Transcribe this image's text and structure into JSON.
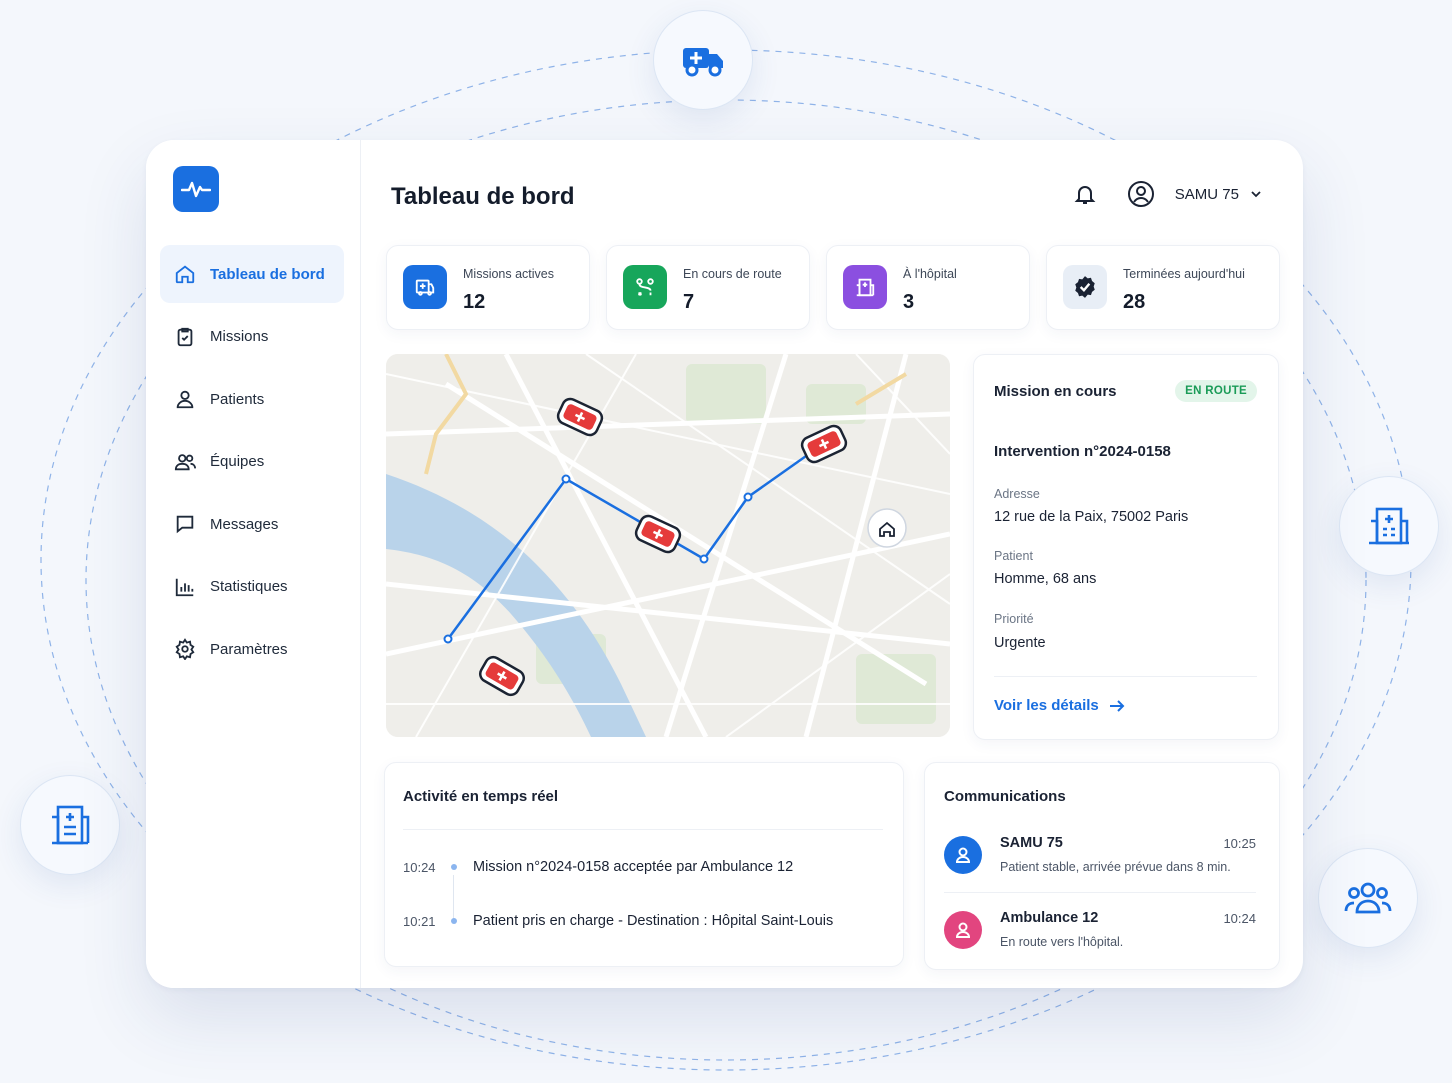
{
  "sidebar": {
    "items": [
      {
        "label": "Tableau de bord",
        "icon": "home-icon",
        "active": true
      },
      {
        "label": "Missions",
        "icon": "clipboard-check-icon"
      },
      {
        "label": "Patients",
        "icon": "user-icon"
      },
      {
        "label": "Équipes",
        "icon": "users-icon"
      },
      {
        "label": "Messages",
        "icon": "message-icon"
      },
      {
        "label": "Statistiques",
        "icon": "bar-chart-icon"
      },
      {
        "label": "Paramètres",
        "icon": "gear-icon"
      }
    ]
  },
  "header": {
    "title": "Tableau de bord",
    "user": "SAMU 75"
  },
  "stats": [
    {
      "label": "Missions actives",
      "value": "12",
      "color": "#1a6fe0",
      "icon": "ambulance-icon"
    },
    {
      "label": "En cours de route",
      "value": "7",
      "color": "#17a65b",
      "icon": "route-icon"
    },
    {
      "label": "À l'hôpital",
      "value": "3",
      "color": "#8b4fe0",
      "icon": "hospital-icon"
    },
    {
      "label": "Terminées aujourd'hui",
      "value": "28",
      "color": "#1a2233",
      "icon": "check-badge-icon"
    }
  ],
  "mission": {
    "heading": "Mission en cours",
    "status": "EN ROUTE",
    "number": "Intervention n°2024-0158",
    "address_label": "Adresse",
    "address": "12 rue de la Paix, 75002 Paris",
    "patient_label": "Patient",
    "patient": "Homme, 68 ans",
    "priority_label": "Priorité",
    "priority": "Urgente",
    "details_link": "Voir les détails"
  },
  "activity": {
    "heading": "Activité en temps réel",
    "items": [
      {
        "time": "10:24",
        "text": "Mission n°2024-0158 acceptée par Ambulance 12"
      },
      {
        "time": "10:21",
        "text": "Patient pris en charge - Destination : Hôpital Saint-Louis"
      }
    ]
  },
  "communications": {
    "heading": "Communications",
    "items": [
      {
        "from": "SAMU 75",
        "time": "10:25",
        "text": "Patient stable, arrivée prévue dans 8 min.",
        "color": "#1a6fe0"
      },
      {
        "from": "Ambulance 12",
        "time": "10:24",
        "text": "En route vers l'hôpital.",
        "color": "#e2457f"
      }
    ]
  }
}
